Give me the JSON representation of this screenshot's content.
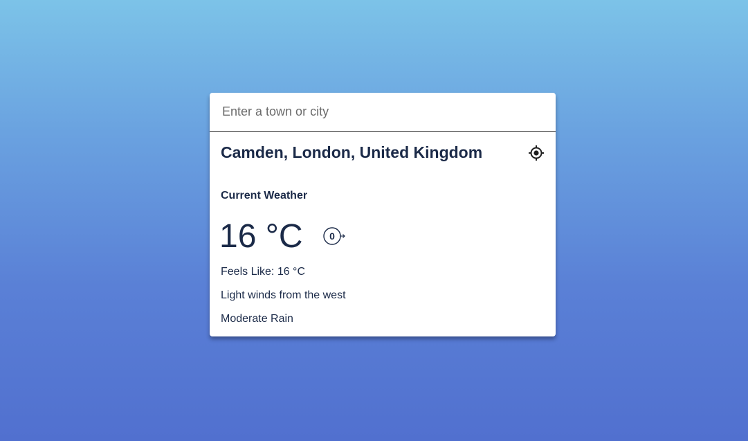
{
  "search": {
    "placeholder": "Enter a town or city",
    "value": ""
  },
  "location": {
    "name": "Camden, London, United Kingdom",
    "locate_icon": "crosshair-target-icon"
  },
  "weather": {
    "section_title": "Current Weather",
    "temperature": "16 °C",
    "wind_speed": "0",
    "wind_direction_icon": "wind-direction-arrow-icon",
    "feels_like_label": "Feels Like",
    "feels_like_value": "16 °C",
    "wind_description": "Light winds from the west",
    "condition": "Moderate Rain"
  },
  "colors": {
    "background_top": "#7cc3e8",
    "background_bottom": "#5170cf",
    "text": "#1b2a48",
    "card": "#ffffff"
  }
}
